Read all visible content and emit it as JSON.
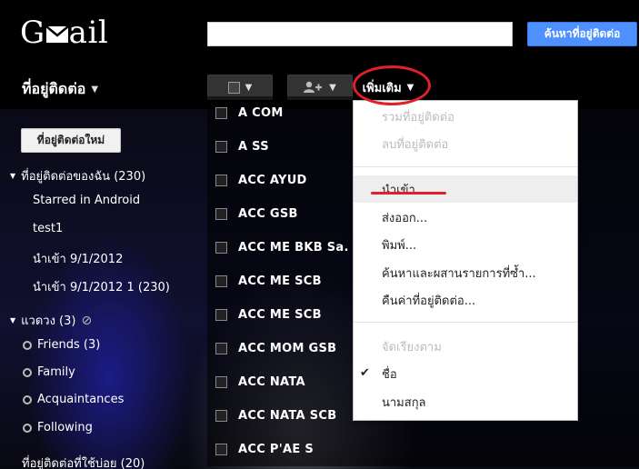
{
  "app": {
    "logo_g": "G",
    "logo_rest": "ail"
  },
  "search": {
    "value": "",
    "placeholder": "",
    "button_label": "ค้นหาที่อยู่ติดต่อ"
  },
  "header": {
    "title": "ที่อยู่ติดต่อ"
  },
  "toolbar": {
    "more_label": "เพิ่มเติม"
  },
  "sidebar": {
    "new_contact_label": "ที่อยู่ติดต่อใหม่",
    "my_contacts": "ที่อยู่ติดต่อของฉัน (230)",
    "items": [
      "Starred in Android",
      "test1",
      "นำเข้า 9/1/2012",
      "นำเข้า 9/1/2012 1 (230)"
    ],
    "circles": "แวดวง (3)",
    "circle_items": [
      "Friends (3)",
      "Family",
      "Acquaintances",
      "Following"
    ],
    "other_contacts": "ที่อยู่ติดต่อที่ใช้บ่อย (20)"
  },
  "contacts": [
    "A COM",
    "A SS",
    "ACC AYUD",
    "ACC GSB",
    "ACC ME BKB Sa.",
    "ACC ME SCB",
    "ACC ME SCB",
    "ACC MOM GSB",
    "ACC NATA",
    "ACC NATA SCB",
    "ACC P'AE S"
  ],
  "menu": {
    "group1": [
      "รวมที่อยู่ติดต่อ",
      "ลบที่อยู่ติดต่อ"
    ],
    "group2": [
      "นำเข้า...",
      "ส่งออก...",
      "พิมพ์...",
      "ค้นหาและผสานรายการที่ซ้ำ...",
      "คืนค่าที่อยู่ติดต่อ..."
    ],
    "sort_header": "จัดเรียงตาม",
    "sort_options": [
      "ชื่อ",
      "นามสกุล"
    ]
  },
  "colors": {
    "accent_blue": "#4d90fe",
    "highlight_red": "#e0202a"
  }
}
